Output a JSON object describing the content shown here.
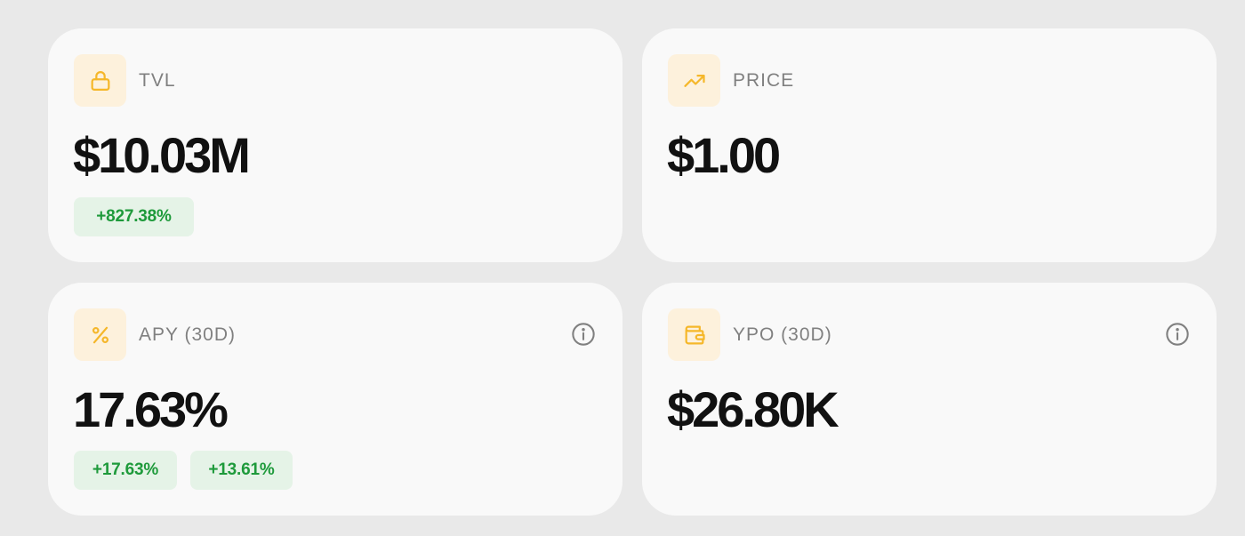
{
  "colors": {
    "page_bg": "#e9e9e9",
    "card_bg": "#f9f9f9",
    "icon_bg": "#fdf1dc",
    "icon_accent": "#f5b72a",
    "label": "#808080",
    "value": "#111111",
    "badge_bg": "#e5f3e7",
    "badge_text": "#1e9a3b"
  },
  "cards": [
    {
      "id": "tvl",
      "icon": "lock-icon",
      "label": "TVL",
      "value": "$10.03M",
      "badges": [
        "+827.38%"
      ],
      "has_info": false
    },
    {
      "id": "price",
      "icon": "trending-up-icon",
      "label": "PRICE",
      "value": "$1.00",
      "badges": [],
      "has_info": false
    },
    {
      "id": "apy",
      "icon": "percent-icon",
      "label": "APY (30D)",
      "value": "17.63%",
      "badges": [
        "+17.63%",
        "+13.61%"
      ],
      "has_info": true,
      "info_icon": "info-icon"
    },
    {
      "id": "ypo",
      "icon": "wallet-icon",
      "label": "YPO (30D)",
      "value": "$26.80K",
      "badges": [],
      "has_info": true,
      "info_icon": "info-icon"
    }
  ]
}
